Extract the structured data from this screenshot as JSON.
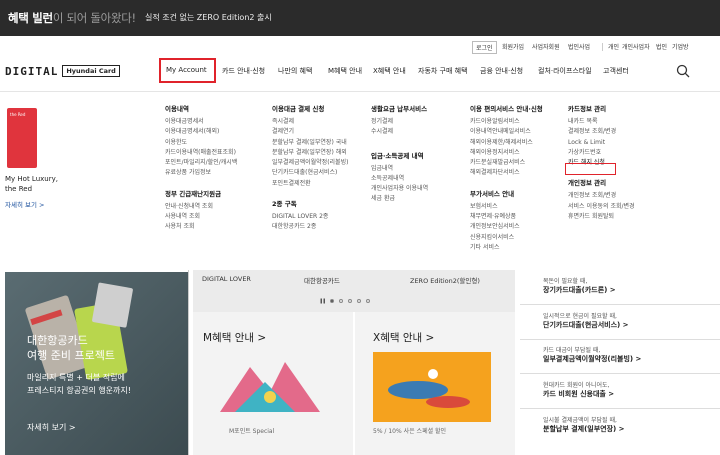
{
  "banner": {
    "highlight": "혜택 빌런",
    "rest": "이 되어 돌아왔다!",
    "notice": "실적 조건 없는 ZERO Edition2 출시"
  },
  "util": {
    "login": "로그인",
    "items": [
      "회원가입",
      "회원가입",
      "사업자회원",
      "법인사업",
      "개인",
      "개인사업자",
      "법인",
      "기업방"
    ]
  },
  "gnb": {
    "logo": "DIGITAL",
    "logo_badge": "Hyundai Card",
    "items": [
      "My Account",
      "카드 안내·신청",
      "나만의 혜택",
      "M혜택 안내",
      "X혜택 안내",
      "자동차 구매 혜택",
      "금융 안내·신청",
      "컬처·라이프스타일",
      "고객센터"
    ]
  },
  "side": {
    "card_label": "the Red",
    "line1": "My Hot Luxury,",
    "line2": "the Red",
    "link": "자세히 보기 >"
  },
  "menu": {
    "col1": {
      "head": "이용내역",
      "items": [
        "이용대금명세서",
        "이용대금명세서(해외)",
        "이용한도",
        "카드이용내역(매출전표조회)",
        "포인트/마일리지/할인/캐시백",
        "유료상품 가입정보"
      ],
      "head2": "정부 긴급재난지원금",
      "items2": [
        "안내·신청내역 조회",
        "사용내역 조회",
        "사용처 조회"
      ]
    },
    "col2": {
      "head": "이용대금 결제 신청",
      "items": [
        "즉시결제",
        "결제연기",
        "분할납부 결제(일부연장) 국내",
        "분할납부 결제(일부연장) 해외",
        "일부결제금액이월약정(리볼빙)",
        "단기카드대출(현금서비스)",
        "포인트결제전환"
      ],
      "head2": "2종 구독",
      "items2": [
        "DIGITAL LOVER 2종",
        "대한항공카드 2종"
      ]
    },
    "col3": {
      "head": "생활요금 납부서비스",
      "items": [
        "정기결제",
        "수시결제"
      ],
      "head2": "입금·소득공제 내역",
      "items2": [
        "입금내역",
        "소득공제내역",
        "개인사업자용 이용내역",
        "세금 환급"
      ]
    },
    "col4": {
      "head": "이용 편의서비스 안내·신청",
      "items": [
        "카드이용알림서비스",
        "이용내역안내메일서비스",
        "해외이용제한/해제서비스",
        "해외이용정지서비스",
        "카드분실재발급서비스",
        "해외결제차단서비스"
      ],
      "head2": "부가서비스 안내",
      "items2": [
        "보험서비스",
        "채무면제·유예상품",
        "개인정보안심서비스",
        "신용지킴이서비스",
        "기타 서비스"
      ]
    },
    "col5": {
      "head": "카드정보 관리",
      "items": [
        "내카드 목록",
        "결제정보 조회/변경",
        "Lock & Limit",
        "가상카드번호",
        "카드 해지 신청"
      ],
      "head2": "개인정보 관리",
      "items2": [
        "개인정보 조회/변경",
        "서비스 이용동의 조회/변경",
        "휴면카드 회원탈퇴"
      ]
    }
  },
  "ad": {
    "t1": "대한항공카드",
    "t2": "여행 준비 프로젝트",
    "t3": "마일리지 특별 + 더블 적립에",
    "t4": "프레스티지 항공권의 행운까지!",
    "link": "자세히 보기 >"
  },
  "slider": {
    "tabs": [
      "DIGITAL LOVER",
      "대한항공카드",
      "ZERO Edition2(할인형)"
    ]
  },
  "mcards": [
    {
      "title": "M혜택 안내 >",
      "sub": "M포인트 Special"
    },
    {
      "title": "X혜택 안내 >",
      "sub": "5% / 10% 사은 스페셜 할인"
    }
  ],
  "right": [
    {
      "small": "목돈이 필요할 때,",
      "bold": "장기카드대출(카드론) >"
    },
    {
      "small": "일시적으로 현금이 필요할 때,",
      "bold": "단기카드대출(현금서비스) >"
    },
    {
      "small": "카드 대금이 부담될 때,",
      "bold": "일부결제금액이월약정(리볼빙) >"
    },
    {
      "small": "현대카드 회원이 아니어도,",
      "bold": "카드 비회원 신용대출 >"
    },
    {
      "small": "일시불 결제금액이 부담될 때,",
      "bold": "분할납부 결제(일부연장) >"
    }
  ],
  "colors": {
    "accent": "#e0232b",
    "banner_bg": "#2b2b2b"
  }
}
